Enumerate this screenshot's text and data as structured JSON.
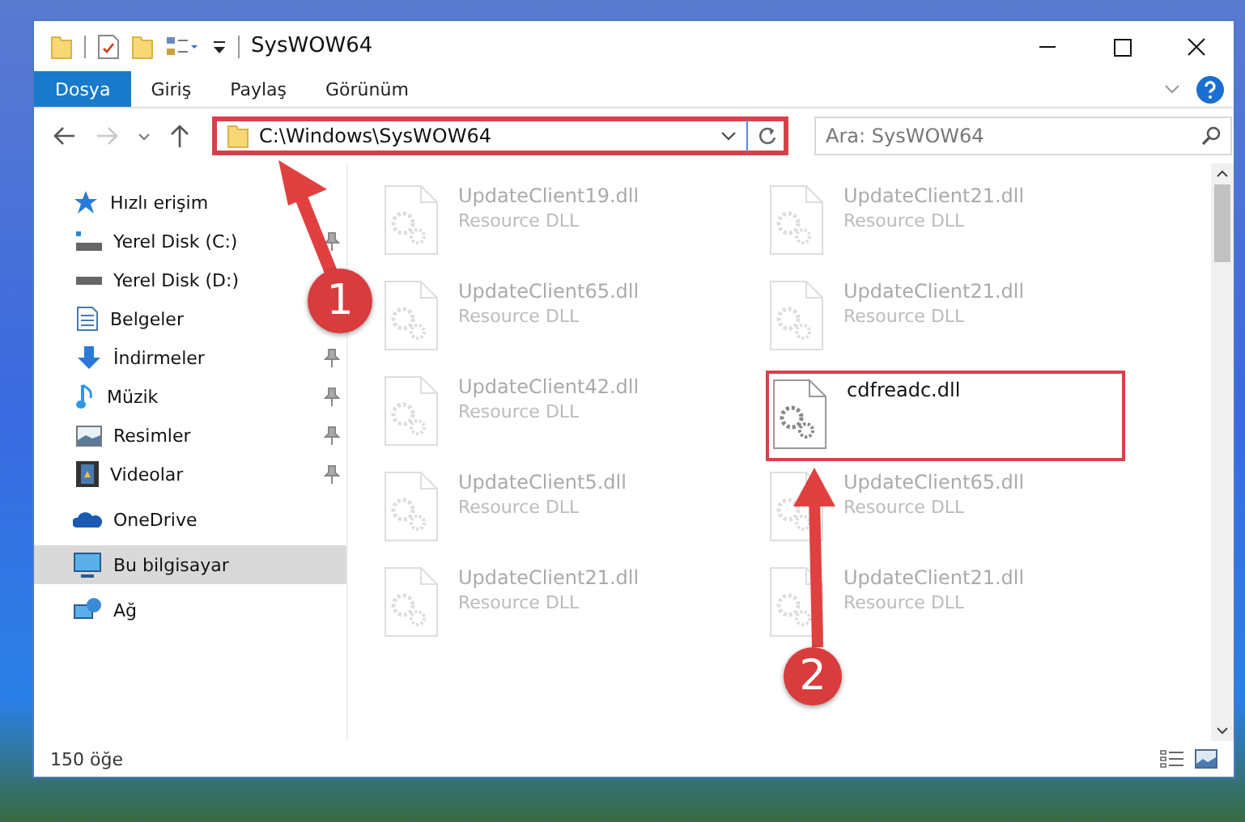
{
  "window": {
    "title": "SysWOW64"
  },
  "ribbon_tabs": [
    {
      "label": "Dosya",
      "kind": "file"
    },
    {
      "label": "Giriş",
      "kind": "tab"
    },
    {
      "label": "Paylaş",
      "kind": "tab"
    },
    {
      "label": "Görünüm",
      "kind": "tab"
    }
  ],
  "address_bar": {
    "path": "C:\\Windows\\SysWOW64",
    "highlighted": true
  },
  "search": {
    "placeholder": "Ara: SysWOW64"
  },
  "sidebar": {
    "items": [
      {
        "label": "Hızlı erişim",
        "kind": "star",
        "selected": false,
        "children": [
          {
            "label": "Yerel Disk (C:)",
            "kind": "system-drive",
            "pinned": true,
            "selected": false
          },
          {
            "label": "Yerel Disk (D:)",
            "kind": "drive",
            "selected": false
          },
          {
            "label": "Belgeler",
            "kind": "document",
            "selected": false
          },
          {
            "label": "İndirmeler",
            "kind": "download",
            "pinned": true,
            "selected": false
          },
          {
            "label": "Müzik",
            "kind": "music",
            "pinned": true,
            "selected": false
          },
          {
            "label": "Resimler",
            "kind": "picture",
            "pinned": true,
            "selected": false
          },
          {
            "label": "Videolar",
            "kind": "film",
            "pinned": true,
            "selected": false
          }
        ]
      },
      {
        "label": "OneDrive",
        "kind": "cloud",
        "selected": false
      },
      {
        "label": "Bu bilgisayar",
        "kind": "computer",
        "selected": true
      },
      {
        "label": "Ağ",
        "kind": "network",
        "selected": false
      }
    ]
  },
  "files": [
    {
      "name": "UpdateClient19.dll",
      "type": "Resource DLL",
      "dimmed": true,
      "highlighted": false
    },
    {
      "name": "UpdateClient21.dll",
      "type": "Resource DLL",
      "dimmed": true,
      "highlighted": false
    },
    {
      "name": "UpdateClient65.dll",
      "type": "Resource DLL",
      "dimmed": true,
      "highlighted": false
    },
    {
      "name": "UpdateClient21.dll",
      "type": "Resource DLL",
      "dimmed": true,
      "highlighted": false
    },
    {
      "name": "UpdateClient42.dll",
      "type": "Resource DLL",
      "dimmed": true,
      "highlighted": false
    },
    {
      "name": "cdfreadc.dll",
      "dimmed": false,
      "highlighted": true
    },
    {
      "name": "UpdateClient5.dll",
      "type": "Resource DLL",
      "dimmed": true,
      "highlighted": false
    },
    {
      "name": "UpdateClient65.dll",
      "type": "Resource DLL",
      "dimmed": true,
      "highlighted": false
    },
    {
      "name": "UpdateClient21.dll",
      "type": "Resource DLL",
      "dimmed": true,
      "highlighted": false
    },
    {
      "name": "UpdateClient21.dll",
      "type": "Resource DLL",
      "dimmed": true,
      "highlighted": false
    }
  ],
  "status_bar": {
    "item_count": "150 öğe"
  },
  "callouts": [
    {
      "label": "1"
    },
    {
      "label": "2"
    }
  ]
}
